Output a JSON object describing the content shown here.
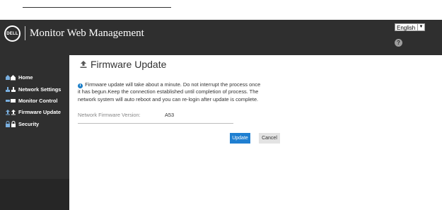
{
  "header": {
    "logo_text": "DELL",
    "app_title": "Monitor Web Management",
    "language": "English",
    "help_glyph": "?"
  },
  "sidebar": {
    "items": [
      {
        "label": "Home",
        "icon": "home-icon"
      },
      {
        "label": "Network Settings",
        "icon": "network-icon"
      },
      {
        "label": "Monitor Control",
        "icon": "monitor-control-icon"
      },
      {
        "label": "Firmware Update",
        "icon": "upload-icon"
      },
      {
        "label": "Security",
        "icon": "lock-icon"
      }
    ]
  },
  "main": {
    "title": "Firmware Update",
    "info_lines": [
      "Firmware update will take about a minute. Do not interrupt the process once",
      "it has begun.Keep the connection established until completion of process. The",
      "network system will auto reboot and you can re-login after update is complete."
    ],
    "firmware_label": "Network Firmware Version:",
    "firmware_value": "A53",
    "update_button": "Update",
    "cancel_button": "Cancel"
  },
  "colors": {
    "header_bg": "#2f2f2f",
    "accent_blue": "#1f7fd1",
    "info_blue": "#1a7ec8"
  }
}
